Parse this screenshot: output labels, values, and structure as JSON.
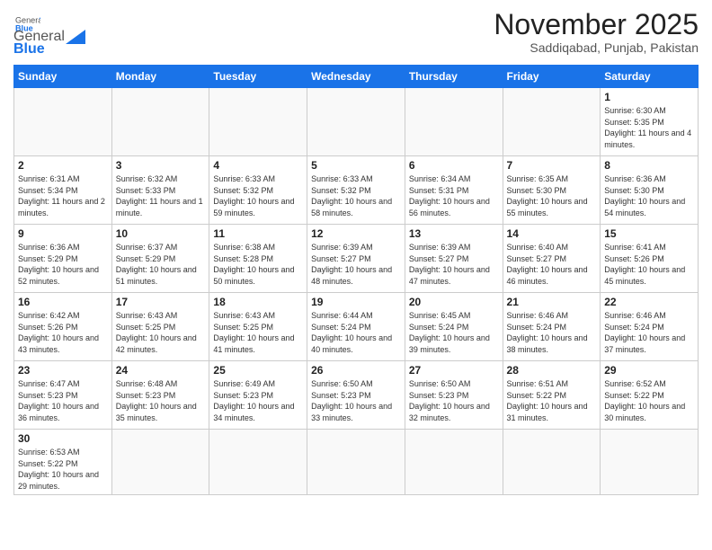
{
  "logo": {
    "text_general": "General",
    "text_blue": "Blue"
  },
  "header": {
    "month": "November 2025",
    "location": "Saddiqabad, Punjab, Pakistan"
  },
  "days_of_week": [
    "Sunday",
    "Monday",
    "Tuesday",
    "Wednesday",
    "Thursday",
    "Friday",
    "Saturday"
  ],
  "weeks": [
    [
      {
        "day": "",
        "info": ""
      },
      {
        "day": "",
        "info": ""
      },
      {
        "day": "",
        "info": ""
      },
      {
        "day": "",
        "info": ""
      },
      {
        "day": "",
        "info": ""
      },
      {
        "day": "",
        "info": ""
      },
      {
        "day": "1",
        "info": "Sunrise: 6:30 AM\nSunset: 5:35 PM\nDaylight: 11 hours and 4 minutes."
      }
    ],
    [
      {
        "day": "2",
        "info": "Sunrise: 6:31 AM\nSunset: 5:34 PM\nDaylight: 11 hours and 2 minutes."
      },
      {
        "day": "3",
        "info": "Sunrise: 6:32 AM\nSunset: 5:33 PM\nDaylight: 11 hours and 1 minute."
      },
      {
        "day": "4",
        "info": "Sunrise: 6:33 AM\nSunset: 5:32 PM\nDaylight: 10 hours and 59 minutes."
      },
      {
        "day": "5",
        "info": "Sunrise: 6:33 AM\nSunset: 5:32 PM\nDaylight: 10 hours and 58 minutes."
      },
      {
        "day": "6",
        "info": "Sunrise: 6:34 AM\nSunset: 5:31 PM\nDaylight: 10 hours and 56 minutes."
      },
      {
        "day": "7",
        "info": "Sunrise: 6:35 AM\nSunset: 5:30 PM\nDaylight: 10 hours and 55 minutes."
      },
      {
        "day": "8",
        "info": "Sunrise: 6:36 AM\nSunset: 5:30 PM\nDaylight: 10 hours and 54 minutes."
      }
    ],
    [
      {
        "day": "9",
        "info": "Sunrise: 6:36 AM\nSunset: 5:29 PM\nDaylight: 10 hours and 52 minutes."
      },
      {
        "day": "10",
        "info": "Sunrise: 6:37 AM\nSunset: 5:29 PM\nDaylight: 10 hours and 51 minutes."
      },
      {
        "day": "11",
        "info": "Sunrise: 6:38 AM\nSunset: 5:28 PM\nDaylight: 10 hours and 50 minutes."
      },
      {
        "day": "12",
        "info": "Sunrise: 6:39 AM\nSunset: 5:27 PM\nDaylight: 10 hours and 48 minutes."
      },
      {
        "day": "13",
        "info": "Sunrise: 6:39 AM\nSunset: 5:27 PM\nDaylight: 10 hours and 47 minutes."
      },
      {
        "day": "14",
        "info": "Sunrise: 6:40 AM\nSunset: 5:27 PM\nDaylight: 10 hours and 46 minutes."
      },
      {
        "day": "15",
        "info": "Sunrise: 6:41 AM\nSunset: 5:26 PM\nDaylight: 10 hours and 45 minutes."
      }
    ],
    [
      {
        "day": "16",
        "info": "Sunrise: 6:42 AM\nSunset: 5:26 PM\nDaylight: 10 hours and 43 minutes."
      },
      {
        "day": "17",
        "info": "Sunrise: 6:43 AM\nSunset: 5:25 PM\nDaylight: 10 hours and 42 minutes."
      },
      {
        "day": "18",
        "info": "Sunrise: 6:43 AM\nSunset: 5:25 PM\nDaylight: 10 hours and 41 minutes."
      },
      {
        "day": "19",
        "info": "Sunrise: 6:44 AM\nSunset: 5:24 PM\nDaylight: 10 hours and 40 minutes."
      },
      {
        "day": "20",
        "info": "Sunrise: 6:45 AM\nSunset: 5:24 PM\nDaylight: 10 hours and 39 minutes."
      },
      {
        "day": "21",
        "info": "Sunrise: 6:46 AM\nSunset: 5:24 PM\nDaylight: 10 hours and 38 minutes."
      },
      {
        "day": "22",
        "info": "Sunrise: 6:46 AM\nSunset: 5:24 PM\nDaylight: 10 hours and 37 minutes."
      }
    ],
    [
      {
        "day": "23",
        "info": "Sunrise: 6:47 AM\nSunset: 5:23 PM\nDaylight: 10 hours and 36 minutes."
      },
      {
        "day": "24",
        "info": "Sunrise: 6:48 AM\nSunset: 5:23 PM\nDaylight: 10 hours and 35 minutes."
      },
      {
        "day": "25",
        "info": "Sunrise: 6:49 AM\nSunset: 5:23 PM\nDaylight: 10 hours and 34 minutes."
      },
      {
        "day": "26",
        "info": "Sunrise: 6:50 AM\nSunset: 5:23 PM\nDaylight: 10 hours and 33 minutes."
      },
      {
        "day": "27",
        "info": "Sunrise: 6:50 AM\nSunset: 5:23 PM\nDaylight: 10 hours and 32 minutes."
      },
      {
        "day": "28",
        "info": "Sunrise: 6:51 AM\nSunset: 5:22 PM\nDaylight: 10 hours and 31 minutes."
      },
      {
        "day": "29",
        "info": "Sunrise: 6:52 AM\nSunset: 5:22 PM\nDaylight: 10 hours and 30 minutes."
      }
    ],
    [
      {
        "day": "30",
        "info": "Sunrise: 6:53 AM\nSunset: 5:22 PM\nDaylight: 10 hours and 29 minutes."
      },
      {
        "day": "",
        "info": ""
      },
      {
        "day": "",
        "info": ""
      },
      {
        "day": "",
        "info": ""
      },
      {
        "day": "",
        "info": ""
      },
      {
        "day": "",
        "info": ""
      },
      {
        "day": "",
        "info": ""
      }
    ]
  ]
}
